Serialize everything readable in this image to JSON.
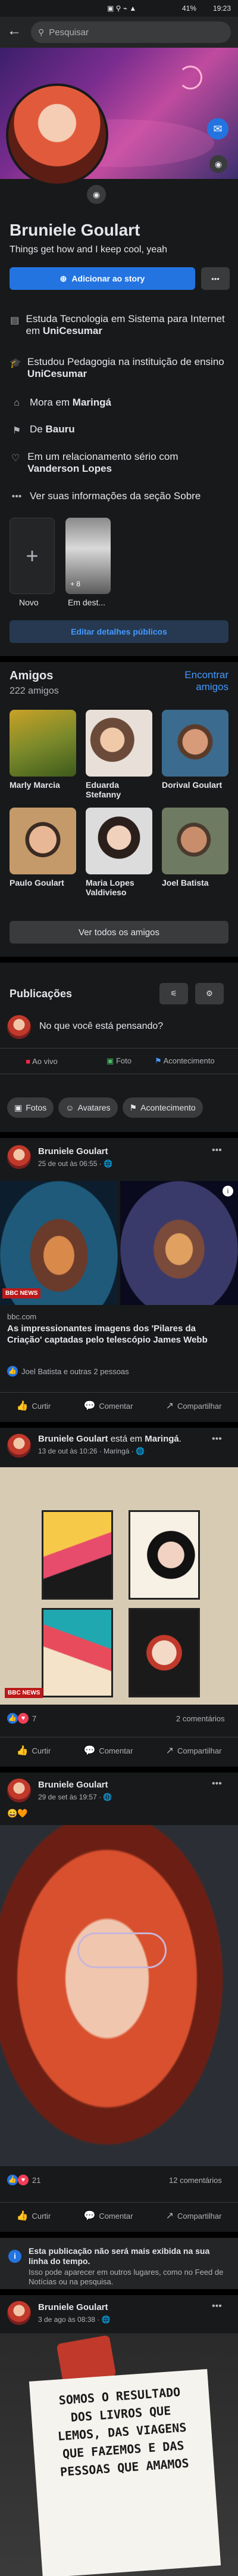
{
  "status_bar": {
    "time": "19:23",
    "battery": "41%",
    "icons": "▣ ⚲ ⌁ ▲"
  },
  "search": {
    "placeholder": "Pesquisar"
  },
  "profile": {
    "name": "Bruniele Goulart",
    "bio": "Things get how and I keep cool, yeah",
    "add_story": "Adicionar ao story",
    "more": "•••"
  },
  "info": [
    {
      "icon": "work-icon",
      "text_pre": "Estuda Tecnologia em Sistema para Internet em ",
      "text_bold": "UniCesumar"
    },
    {
      "icon": "education-icon",
      "text_pre": "Estudou Pedagogia na instituição de ensino ",
      "text_bold": "UniCesumar"
    },
    {
      "icon": "home-icon",
      "text_pre": "Mora em ",
      "text_bold": "Maringá"
    },
    {
      "icon": "location-icon",
      "text_pre": "De ",
      "text_bold": "Bauru"
    },
    {
      "icon": "heart-icon",
      "text_pre": "Em um relacionamento sério com ",
      "text_bold": "Vanderson Lopes"
    },
    {
      "icon": "more-icon",
      "text_pre": "Ver suas informações da seção Sobre",
      "text_bold": ""
    }
  ],
  "featured": {
    "new_label": "Novo",
    "item_label": "Em dest...",
    "item_count": "+ 8"
  },
  "edit_public": "Editar detalhes públicos",
  "friends": {
    "title": "Amigos",
    "count": "222 amigos",
    "find": "Encontrar amigos",
    "list": [
      {
        "name": "Marly Marcia"
      },
      {
        "name": "Eduarda Stefanny"
      },
      {
        "name": "Dorival Goulart"
      },
      {
        "name": "Paulo Goulart"
      },
      {
        "name": "Maria Lopes Valdivieso"
      },
      {
        "name": "Joel Batista"
      }
    ],
    "see_all": "Ver todos os amigos"
  },
  "publications": {
    "title": "Publicações",
    "composer": "No que você está pensando?",
    "actions": [
      "Ao vivo",
      "Foto",
      "Acontecimento"
    ],
    "tabs": [
      "Fotos",
      "Avatares",
      "Acontecimento"
    ]
  },
  "posts": [
    {
      "author": "Bruniele Goulart",
      "date": "25 de out às 06:55 · 🌐",
      "link_domain": "bbc.com",
      "link_title": "As impressionantes imagens dos 'Pilares da Criação' captadas pelo telescópio James Webb",
      "badge": "BBC NEWS",
      "reactions": "Joel Batista e outras 2 pessoas"
    },
    {
      "author": "Bruniele Goulart",
      "author_suffix": " está em ",
      "place": "Maringá",
      "date": "13 de out às 10:26 · Maringá · 🌐",
      "badge": "BBC NEWS",
      "reactions": "7",
      "comments": "2 comentários"
    },
    {
      "author": "Bruniele Goulart",
      "date": "29 de set às 19:57 · 🌐",
      "reactions": "21",
      "comments": "12 comentários"
    },
    {
      "author": "Bruniele Goulart",
      "date": "3 de ago às 08:38 · 🌐",
      "note_text": "SOMOS O RESULTADO DOS LIVROS QUE LEMOS, DAS VIAGENS QUE FAZEMOS E DAS PESSOAS QUE AMAMOS"
    }
  ],
  "post_actions": {
    "like": "Curtir",
    "comment": "Comentar",
    "share": "Compartilhar"
  },
  "notice": {
    "title": "Esta publicação não será mais exibida na sua linha do tempo.",
    "body": "Isso pode aparecer em outros lugares, como no Feed de Notícias ou na pesquisa."
  },
  "colors": {
    "accent": "#2374e1",
    "bg": "#18191a",
    "card": "#242526"
  }
}
